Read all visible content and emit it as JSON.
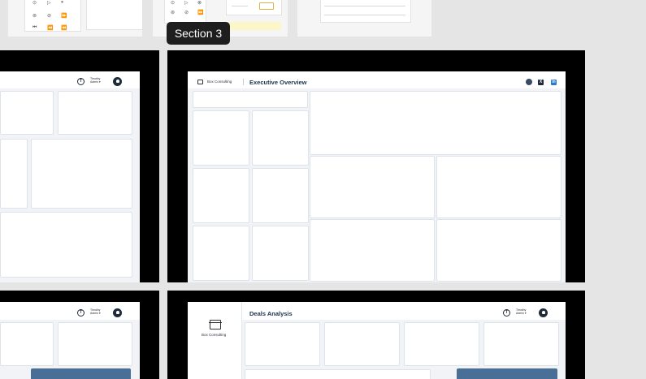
{
  "tooltip": {
    "label": "Section 3"
  },
  "pages": {
    "top_left": {
      "user_name": "Timothy",
      "user_sub": "Admin ▾",
      "avatar_letter": "T"
    },
    "executive_overview": {
      "brand": "Box Consulting",
      "title": "Executive Overview",
      "social": [
        "globe-icon",
        "x-icon",
        "linkedin-icon"
      ],
      "x_glyph": "X",
      "linkedin_glyph": "in"
    },
    "bottom_left": {
      "user_name": "Timothy",
      "user_sub": "Admin ▾",
      "avatar_letter": "T"
    },
    "deals_analysis": {
      "brand": "Box Consulting",
      "title": "Deals Analysis",
      "user_name": "Timothy",
      "user_sub": "Admin ▾",
      "avatar_letter": "T"
    }
  },
  "thumbnails": {
    "media_controls": [
      "⊙",
      "▷",
      "⏸",
      "⊚",
      "⊘",
      "⏩",
      "⏮",
      "⏪",
      "⏪"
    ],
    "sidebar_glyphs": [
      "⊙",
      "▷",
      "⊗",
      "⊚",
      "⊘",
      "⏩"
    ]
  },
  "colors": {
    "accent": "#4a6f96",
    "linkedin": "#2b7bc9",
    "frame": "#000000",
    "tooltip_bg": "#1e1e1e"
  }
}
